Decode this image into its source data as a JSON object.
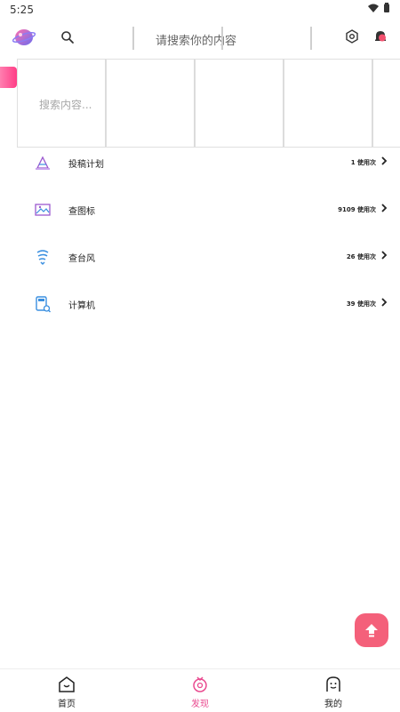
{
  "status": {
    "time": "5:25"
  },
  "header": {
    "search_placeholder": "请搜索你的内容"
  },
  "grid": {
    "search_hint": "搜索内容..."
  },
  "tools": [
    {
      "name": "投稿计划",
      "usage": "1 使用次"
    },
    {
      "name": "查图标",
      "usage": "9109 使用次"
    },
    {
      "name": "查台风",
      "usage": "26 使用次"
    },
    {
      "name": "计算机",
      "usage": "39 使用次"
    }
  ],
  "nav": {
    "home": "首页",
    "discover": "发现",
    "mine": "我的",
    "active": "discover"
  },
  "colors": {
    "accent": "#e94a8f",
    "fab": "#f4607a",
    "icon_blue": "#3a8fe0",
    "icon_purple": "#9b59d0"
  }
}
